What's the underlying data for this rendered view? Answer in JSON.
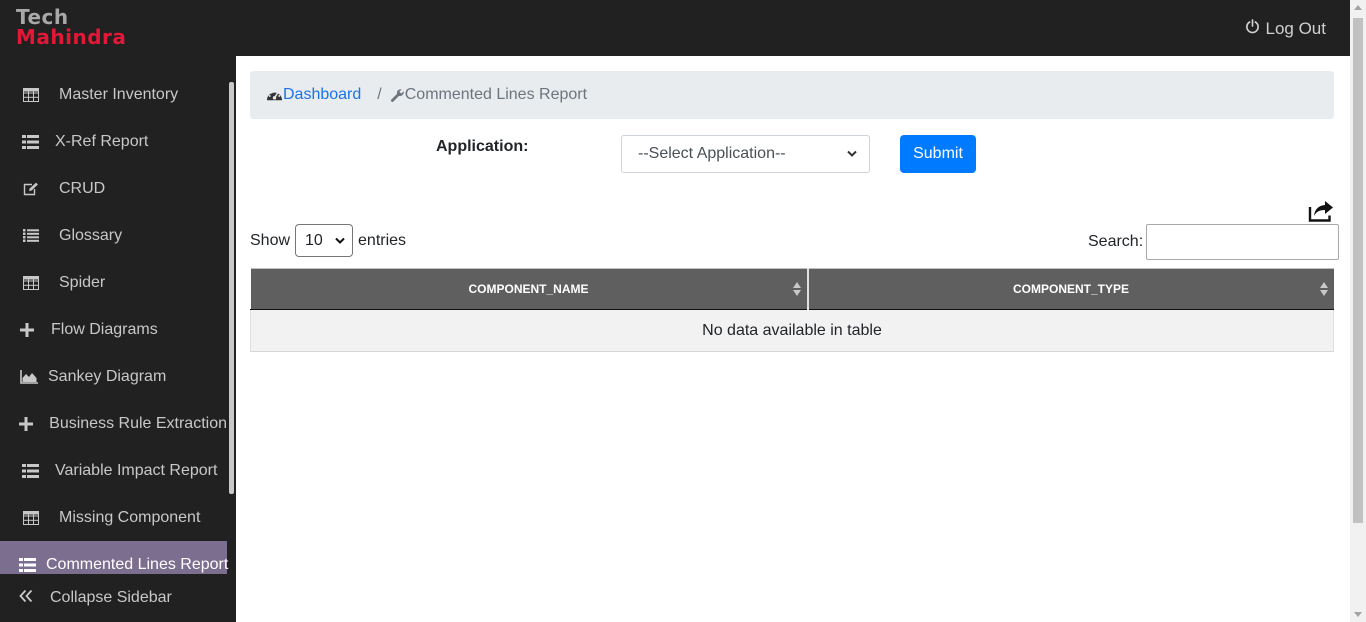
{
  "brand": {
    "line1": "Tech",
    "line2": "Mahindra"
  },
  "header": {
    "logout_label": "Log Out",
    "logout_icon": "power-icon"
  },
  "sidebar": {
    "items": [
      {
        "label": "Master Inventory",
        "icon": "table-icon",
        "active": false
      },
      {
        "label": "X-Ref Report",
        "icon": "list-icon",
        "active": false
      },
      {
        "label": "CRUD",
        "icon": "edit-icon",
        "active": false
      },
      {
        "label": "Glossary",
        "icon": "list-icon",
        "active": false
      },
      {
        "label": "Spider",
        "icon": "table-icon",
        "active": false
      },
      {
        "label": "Flow Diagrams",
        "icon": "plus-icon",
        "active": false
      },
      {
        "label": "Sankey Diagram",
        "icon": "area-chart-icon",
        "active": false
      },
      {
        "label": "Business Rule Extraction",
        "icon": "plus-icon",
        "active": false
      },
      {
        "label": "Variable Impact Report",
        "icon": "list-icon",
        "active": false
      },
      {
        "label": "Missing Component",
        "icon": "table-icon",
        "active": false
      },
      {
        "label": "Commented Lines Report",
        "icon": "list-icon",
        "active": true
      }
    ],
    "collapse_label": "Collapse Sidebar"
  },
  "breadcrumb": {
    "home_label": "Dashboard",
    "separator": "/",
    "current_label": "Commented Lines Report"
  },
  "form": {
    "application_label": "Application:",
    "application_select_value": "--Select Application--",
    "submit_label": "Submit"
  },
  "table_controls": {
    "show_label": "Show",
    "entries_value": "10",
    "entries_label": "entries",
    "search_label": "Search:",
    "search_value": ""
  },
  "table": {
    "columns": [
      "COMPONENT_NAME",
      "COMPONENT_TYPE"
    ],
    "empty_message": "No data available in table"
  },
  "colors": {
    "topbar": "#212121",
    "sidebar_active": "#7b6e8e",
    "brand_red": "#e31837",
    "link": "#1a73e8",
    "submit": "#007bff",
    "table_header": "#5f5f5f"
  }
}
